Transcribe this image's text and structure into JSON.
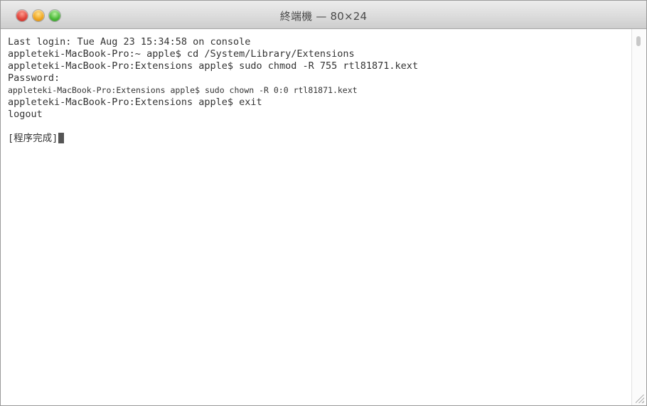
{
  "window": {
    "title": "終端機 — 80×24"
  },
  "terminal": {
    "lines": [
      "Last login: Tue Aug 23 15:34:58 on console",
      "appleteki-MacBook-Pro:~ apple$ cd /System/Library/Extensions",
      "appleteki-MacBook-Pro:Extensions apple$ sudo chmod -R 755 rtl81871.kext",
      "Password:",
      "appleteki-MacBook-Pro:Extensions apple$ sudo chown -R 0:0 rtl81871.kext",
      "appleteki-MacBook-Pro:Extensions apple$ exit",
      "logout",
      "",
      "[程序完成]"
    ]
  }
}
